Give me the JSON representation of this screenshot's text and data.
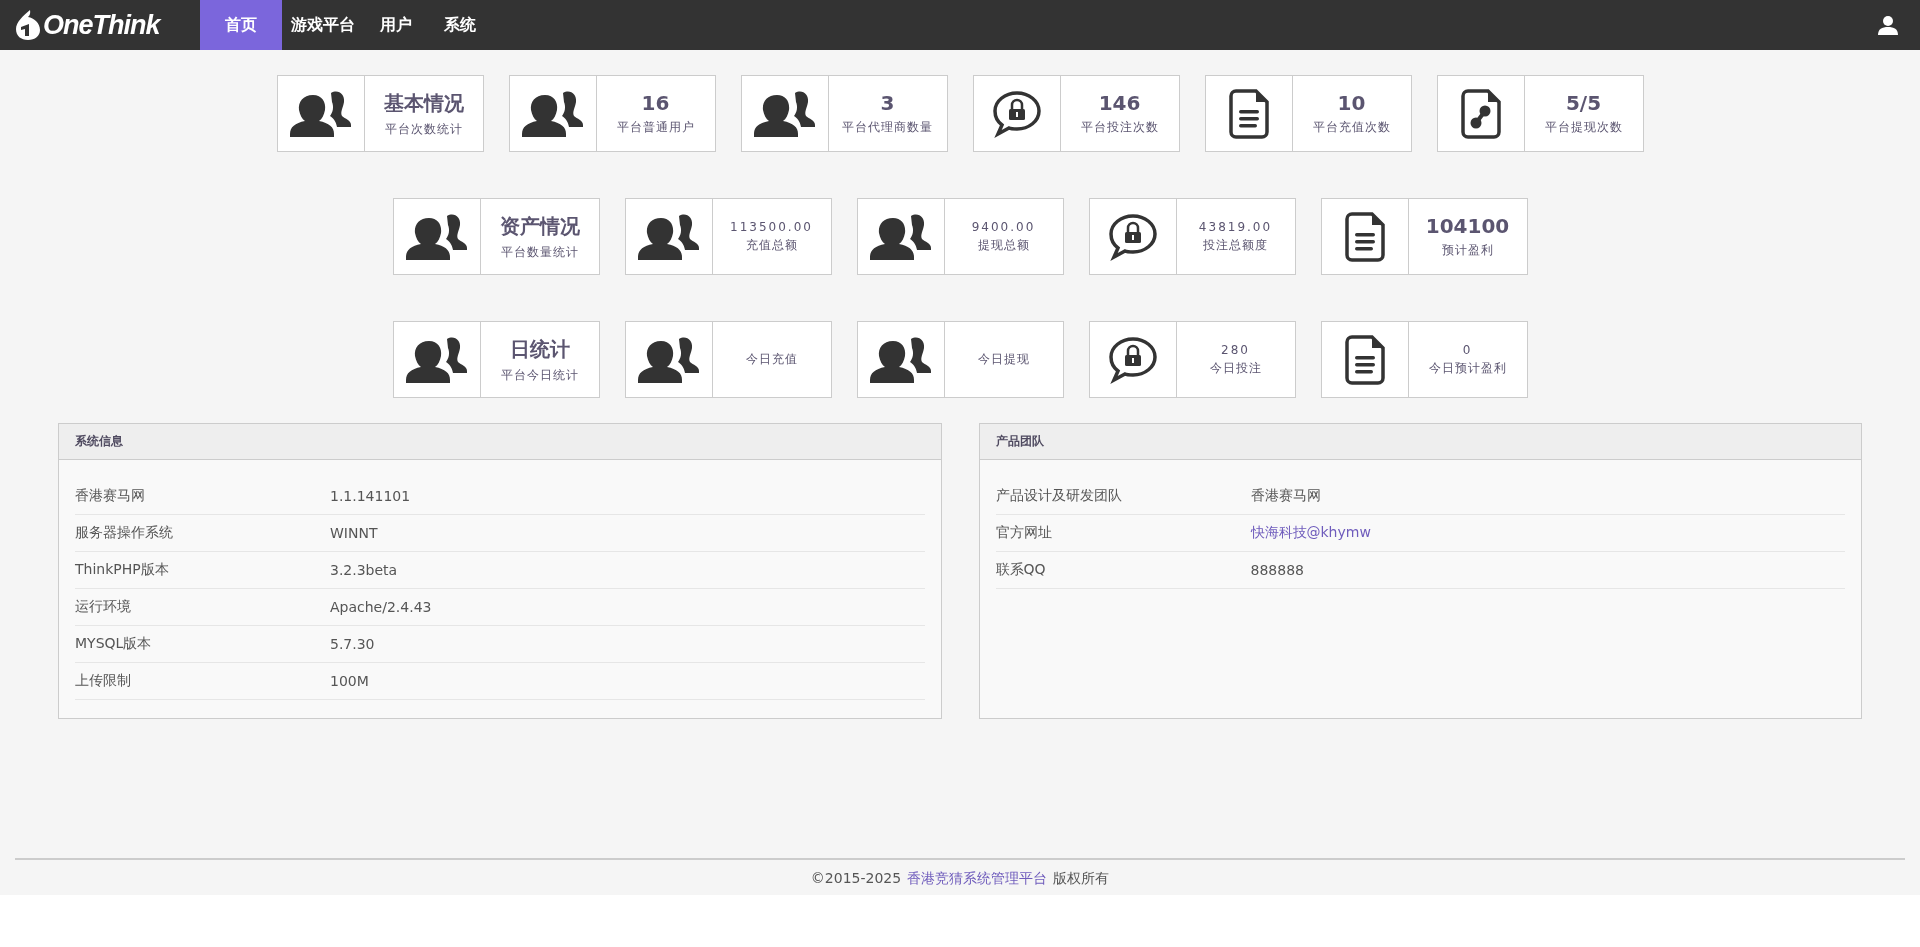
{
  "header": {
    "logo": "OneThink",
    "nav": [
      {
        "label": "首页",
        "selected": true
      },
      {
        "label": "游戏平台",
        "selected": false
      },
      {
        "label": "用户",
        "selected": false
      },
      {
        "label": "系统",
        "selected": false
      }
    ]
  },
  "stat_rows": [
    {
      "cards": [
        {
          "kind": "title",
          "value": "基本情况",
          "label": "平台次数统计"
        },
        {
          "kind": "big",
          "value": "16",
          "label": "平台普通用户"
        },
        {
          "kind": "big",
          "value": "3",
          "label": "平台代理商数量"
        },
        {
          "kind": "big",
          "value": "146",
          "label": "平台投注次数"
        },
        {
          "kind": "big",
          "value": "10",
          "label": "平台充值次数"
        },
        {
          "kind": "big",
          "value": "5/5",
          "label": "平台提现次数"
        }
      ]
    },
    {
      "cards": [
        {
          "kind": "title",
          "value": "资产情况",
          "label": "平台数量统计"
        },
        {
          "kind": "small",
          "value": "113500.00",
          "label": "充值总额"
        },
        {
          "kind": "small",
          "value": "9400.00",
          "label": "提现总额"
        },
        {
          "kind": "small",
          "value": "43819.00",
          "label": "投注总额度"
        },
        {
          "kind": "big",
          "value": "104100",
          "label": "预计盈利"
        }
      ]
    },
    {
      "cards": [
        {
          "kind": "title",
          "value": "日统计",
          "label": "平台今日统计"
        },
        {
          "kind": "small",
          "label": "今日充值"
        },
        {
          "kind": "small",
          "label": "今日提现"
        },
        {
          "kind": "small",
          "value": "280",
          "label": "今日投注"
        },
        {
          "kind": "small",
          "value": "0",
          "label": "今日预计盈利"
        }
      ]
    }
  ],
  "panels": [
    {
      "title": "系统信息",
      "rows": [
        {
          "label": "香港赛马网",
          "value": "1.1.141101"
        },
        {
          "label": "服务器操作系统",
          "value": "WINNT"
        },
        {
          "label": "ThinkPHP版本",
          "value": "3.2.3beta"
        },
        {
          "label": "运行环境",
          "value": "Apache/2.4.43"
        },
        {
          "label": "MYSQL版本",
          "value": "5.7.30"
        },
        {
          "label": "上传限制",
          "value": "100M"
        }
      ]
    },
    {
      "title": "产品团队",
      "rows": [
        {
          "label": "产品设计及研发团队",
          "value": "香港赛马网"
        },
        {
          "label": "官方网址",
          "value": "快海科技@khymw",
          "link": true
        },
        {
          "label": "联系QQ",
          "value": "888888"
        }
      ]
    }
  ],
  "footer": {
    "copyright": "©2015-2025",
    "link": "香港竞猜系统管理平台",
    "suffix": "版权所有"
  }
}
